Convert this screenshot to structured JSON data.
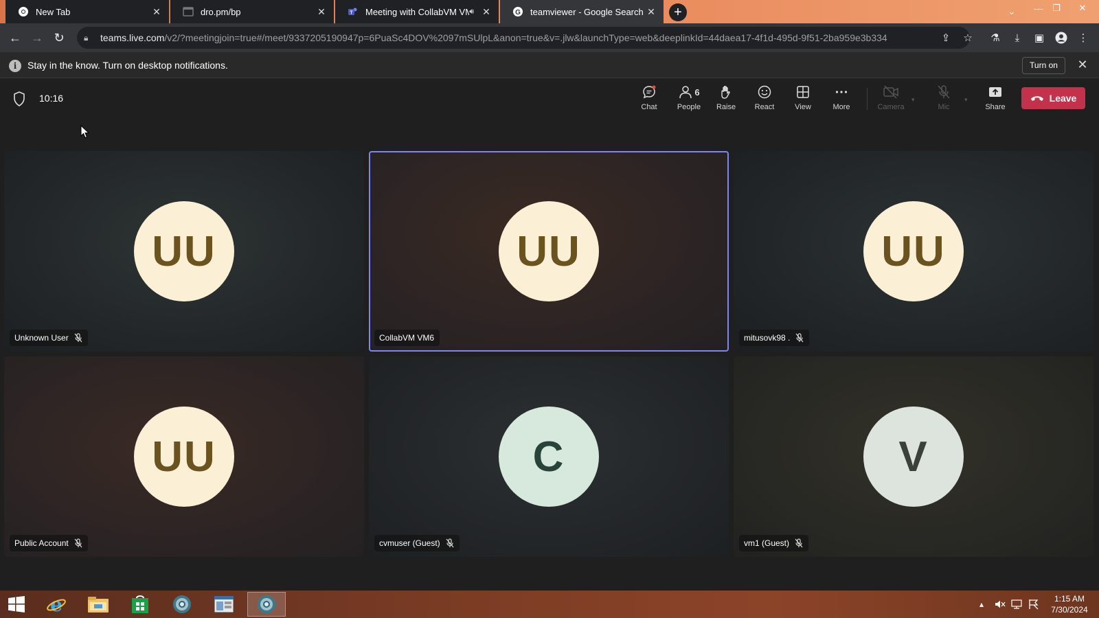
{
  "browser": {
    "tabs": [
      {
        "label": "New Tab",
        "icon": "chrome-icon"
      },
      {
        "label": "dro.pm/bp",
        "icon": "page-icon"
      },
      {
        "label": "Meeting with CollabVM VM",
        "icon": "teams-icon",
        "audio": true
      },
      {
        "label": "teamviewer - Google Search",
        "icon": "google-icon",
        "active": true
      }
    ],
    "url_host": "teams.live.com",
    "url_path": "/v2/?meetingjoin=true#/meet/9337205190947p=6PuaSc4DOV%2097mSUlpL&anon=true&v=.jlw&launchType=web&deeplinkId=44daea17-4f1d-495d-9f51-2ba959e3b334"
  },
  "notification": {
    "text": "Stay in the know. Turn on desktop notifications.",
    "button": "Turn on"
  },
  "meeting": {
    "time": "10:16",
    "controls": {
      "chat": "Chat",
      "people": "People",
      "people_count": "6",
      "raise": "Raise",
      "react": "React",
      "view": "View",
      "more": "More",
      "camera": "Camera",
      "mic": "Mic",
      "share": "Share",
      "leave": "Leave"
    },
    "participants": [
      {
        "name": "Unknown User",
        "initials": "UU",
        "muted": true
      },
      {
        "name": "CollabVM VM6",
        "initials": "UU",
        "muted": false,
        "active": true
      },
      {
        "name": "mitusovk98 .",
        "initials": "UU",
        "muted": true
      },
      {
        "name": "Public Account",
        "initials": "UU",
        "muted": true
      },
      {
        "name": "cvmuser (Guest)",
        "initials": "C",
        "muted": true
      },
      {
        "name": "vm1 (Guest)",
        "initials": "V",
        "muted": true
      }
    ]
  },
  "taskbar": {
    "time": "1:15 AM",
    "date": "7/30/2024",
    "apps": [
      "start-button",
      "internet-explorer-icon",
      "file-explorer-icon",
      "store-icon",
      "chrome-icon",
      "window-icon",
      "chrome-active-icon"
    ]
  },
  "colors": {
    "accent": "#7f85f5",
    "leave_red": "#c4314b",
    "avatar_cream": "#fbf0d6",
    "avatar_mint": "#d7e8dd",
    "avatar_gray": "#dde3dd"
  }
}
